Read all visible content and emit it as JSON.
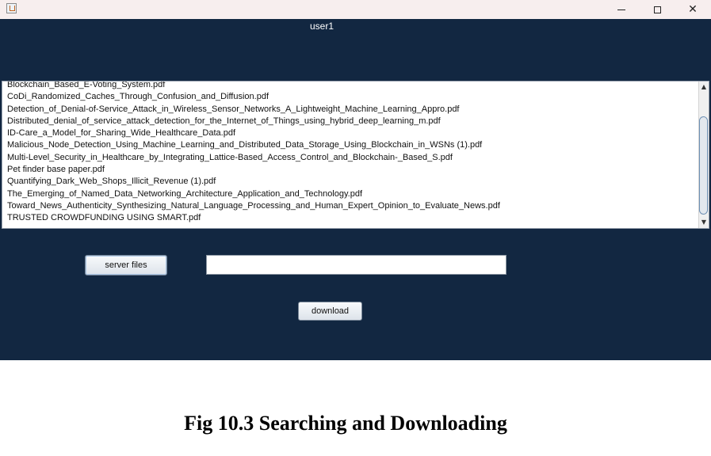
{
  "window": {
    "title_icon": "java-cup-icon",
    "controls": {
      "minimize_icon": "minimize-icon",
      "maximize_icon": "maximize-icon",
      "close_icon": "close-icon",
      "close_glyph": "✕"
    }
  },
  "header": {
    "username": "user1"
  },
  "file_list": {
    "items": [
      "Blockchain_Based_E-Voting_System.pdf",
      "CoDi_Randomized_Caches_Through_Confusion_and_Diffusion.pdf",
      "Detection_of_Denial-of-Service_Attack_in_Wireless_Sensor_Networks_A_Lightweight_Machine_Learning_Appro.pdf",
      "Distributed_denial_of_service_attack_detection_for_the_Internet_of_Things_using_hybrid_deep_learning_m.pdf",
      "ID-Care_a_Model_for_Sharing_Wide_Healthcare_Data.pdf",
      "Malicious_Node_Detection_Using_Machine_Learning_and_Distributed_Data_Storage_Using_Blockchain_in_WSNs (1).pdf",
      "Multi-Level_Security_in_Healthcare_by_Integrating_Lattice-Based_Access_Control_and_Blockchain-_Based_S.pdf",
      "Pet finder base paper.pdf",
      "Quantifying_Dark_Web_Shops_Illicit_Revenue (1).pdf",
      "The_Emerging_of_Named_Data_Networking_Architecture_Application_and_Technology.pdf",
      "Toward_News_Authenticity_Synthesizing_Natural_Language_Processing_and_Human_Expert_Opinion_to_Evaluate_News.pdf",
      "TRUSTED CROWDFUNDING USING SMART.pdf"
    ],
    "scroll_up_glyph": "▲",
    "scroll_down_glyph": "▼"
  },
  "controls": {
    "server_files_label": "server files",
    "path_value": "",
    "download_label": "download"
  },
  "caption": "Fig 10.3 Searching and Downloading",
  "colors": {
    "window_bg": "#122741",
    "titlebar_bg": "#f7eeee",
    "list_bg": "#ffffff"
  }
}
